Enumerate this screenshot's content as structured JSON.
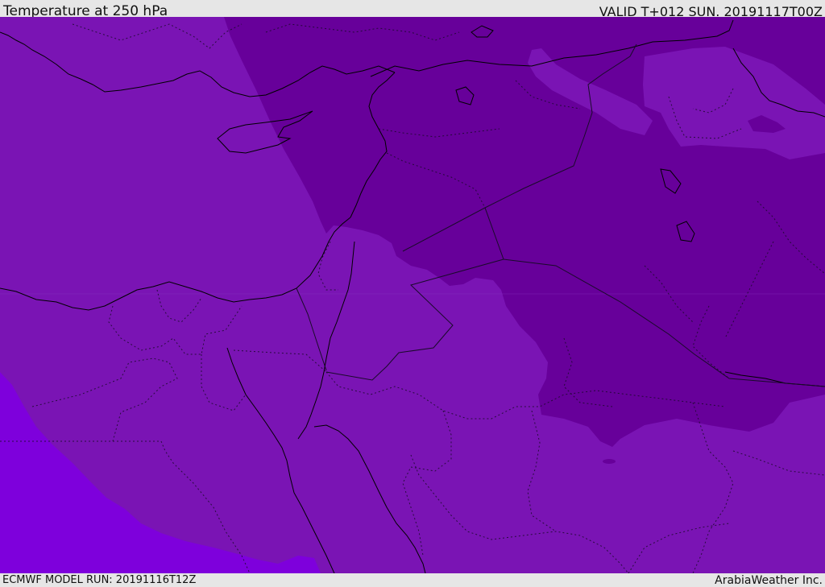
{
  "header": {
    "title": "Temperature at 250 hPa",
    "valid": "VALID T+012 SUN. 20191117T00Z"
  },
  "footer": {
    "model_run": "ECMWF MODEL RUN: 20191116T12Z",
    "credit": "ArabiaWeather Inc."
  },
  "colors": {
    "frame_background": "#e6e6e6",
    "base_temperature_band": "#7a14b4",
    "cold_temperature_band": "#67009a",
    "warm_temperature_band": "#7e00dc",
    "light_patch": "#7a14b4",
    "coastline": "#000000",
    "borders": "#1a0a2a"
  }
}
